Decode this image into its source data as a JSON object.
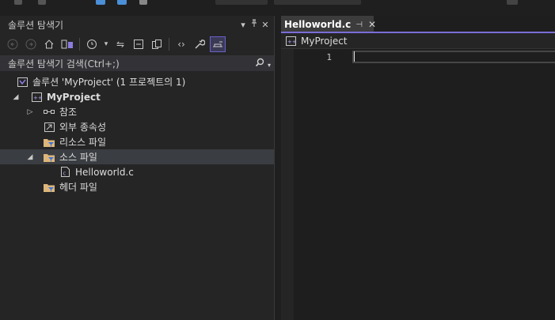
{
  "solution_explorer": {
    "title": "솔루션 탐색기",
    "pin_icon": "pin-icon",
    "close_icon": "close-icon",
    "search_placeholder": "솔루션 탐색기 검색(Ctrl+;)",
    "tree": {
      "solution_label": "솔루션 'MyProject' (1 프로젝트의 1)",
      "project_label": "MyProject",
      "items": [
        {
          "label": "참조",
          "icon": "references-icon",
          "expander": "collapsed"
        },
        {
          "label": "외부 종속성",
          "icon": "external-dependencies-icon"
        },
        {
          "label": "리소스 파일",
          "icon": "folder-filter-icon"
        },
        {
          "label": "소스 파일",
          "icon": "folder-filter-icon",
          "expander": "expanded",
          "selected": true
        },
        {
          "label": "Helloworld.c",
          "icon": "c-file-icon"
        },
        {
          "label": "헤더 파일",
          "icon": "folder-filter-icon"
        }
      ]
    }
  },
  "editor": {
    "tab_label": "Helloworld.c",
    "nav_project": "MyProject",
    "line_numbers": [
      "1"
    ]
  },
  "colors": {
    "accent": "#7a6ed8",
    "panel_bg": "#252526",
    "editor_bg": "#1e1e1e",
    "selection": "#3a3d41"
  }
}
